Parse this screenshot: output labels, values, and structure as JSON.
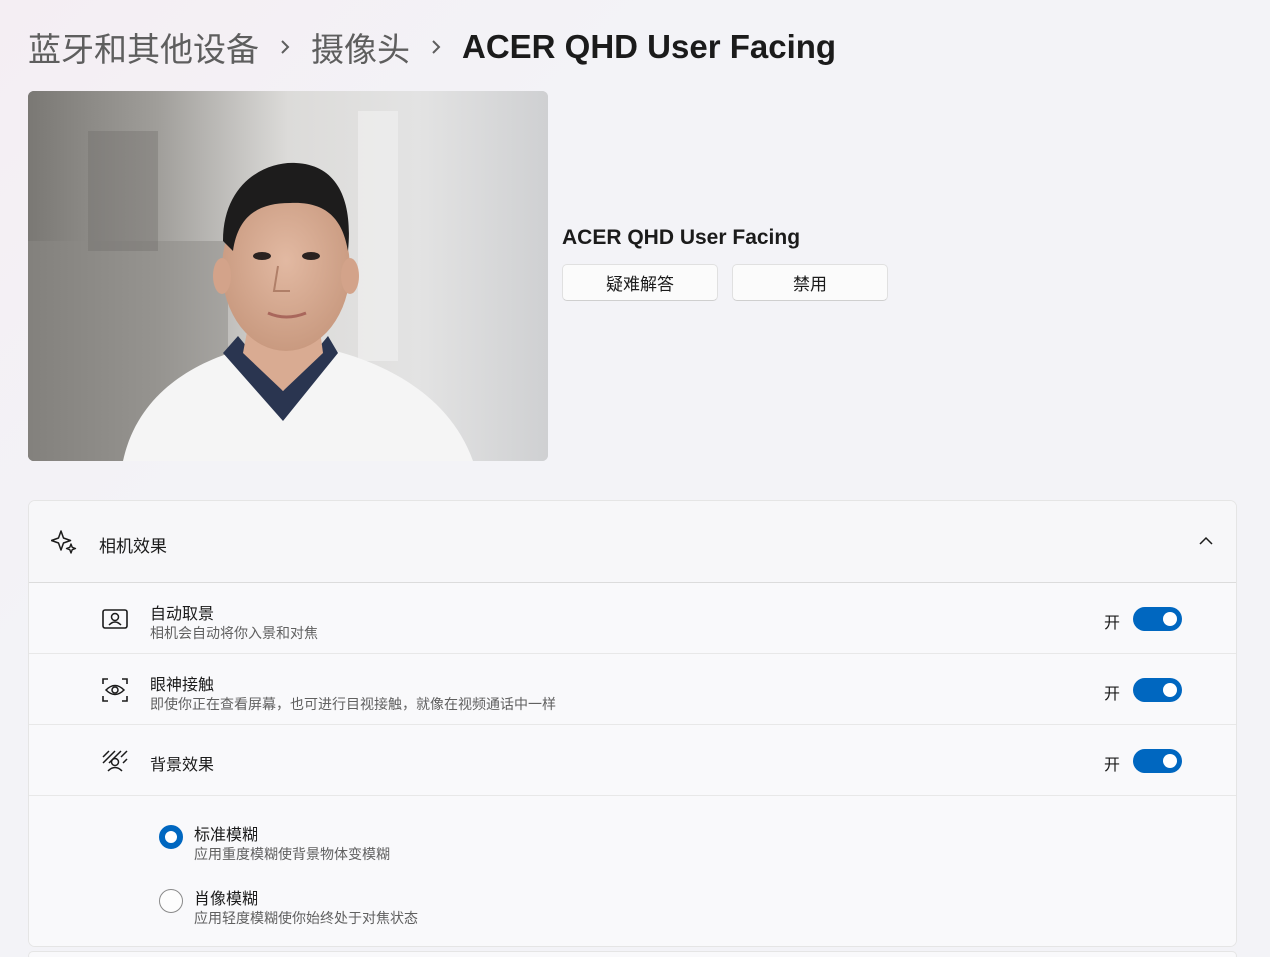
{
  "breadcrumb": {
    "items": [
      "蓝牙和其他设备",
      "摄像头"
    ],
    "current": "ACER QHD User Facing"
  },
  "device": {
    "name": "ACER QHD User Facing",
    "troubleshoot_label": "疑难解答",
    "disable_label": "禁用"
  },
  "camera_effects": {
    "title": "相机效果",
    "settings": [
      {
        "title": "自动取景",
        "description": "相机会自动将你入景和对焦",
        "state": "开",
        "on": true,
        "icon": "auto-framing-icon"
      },
      {
        "title": "眼神接触",
        "description": "即使你正在查看屏幕，也可进行目视接触，就像在视频通话中一样",
        "state": "开",
        "on": true,
        "icon": "eye-contact-icon"
      },
      {
        "title": "背景效果",
        "description": "",
        "state": "开",
        "on": true,
        "icon": "background-effects-icon"
      }
    ],
    "background_options": [
      {
        "title": "标准模糊",
        "description": "应用重度模糊使背景物体变模糊",
        "selected": true
      },
      {
        "title": "肖像模糊",
        "description": "应用轻度模糊使你始终处于对焦状态",
        "selected": false
      }
    ]
  },
  "colors": {
    "accent": "#0067c0",
    "background": "#f3f3f7",
    "card": "#f9f9fb"
  }
}
